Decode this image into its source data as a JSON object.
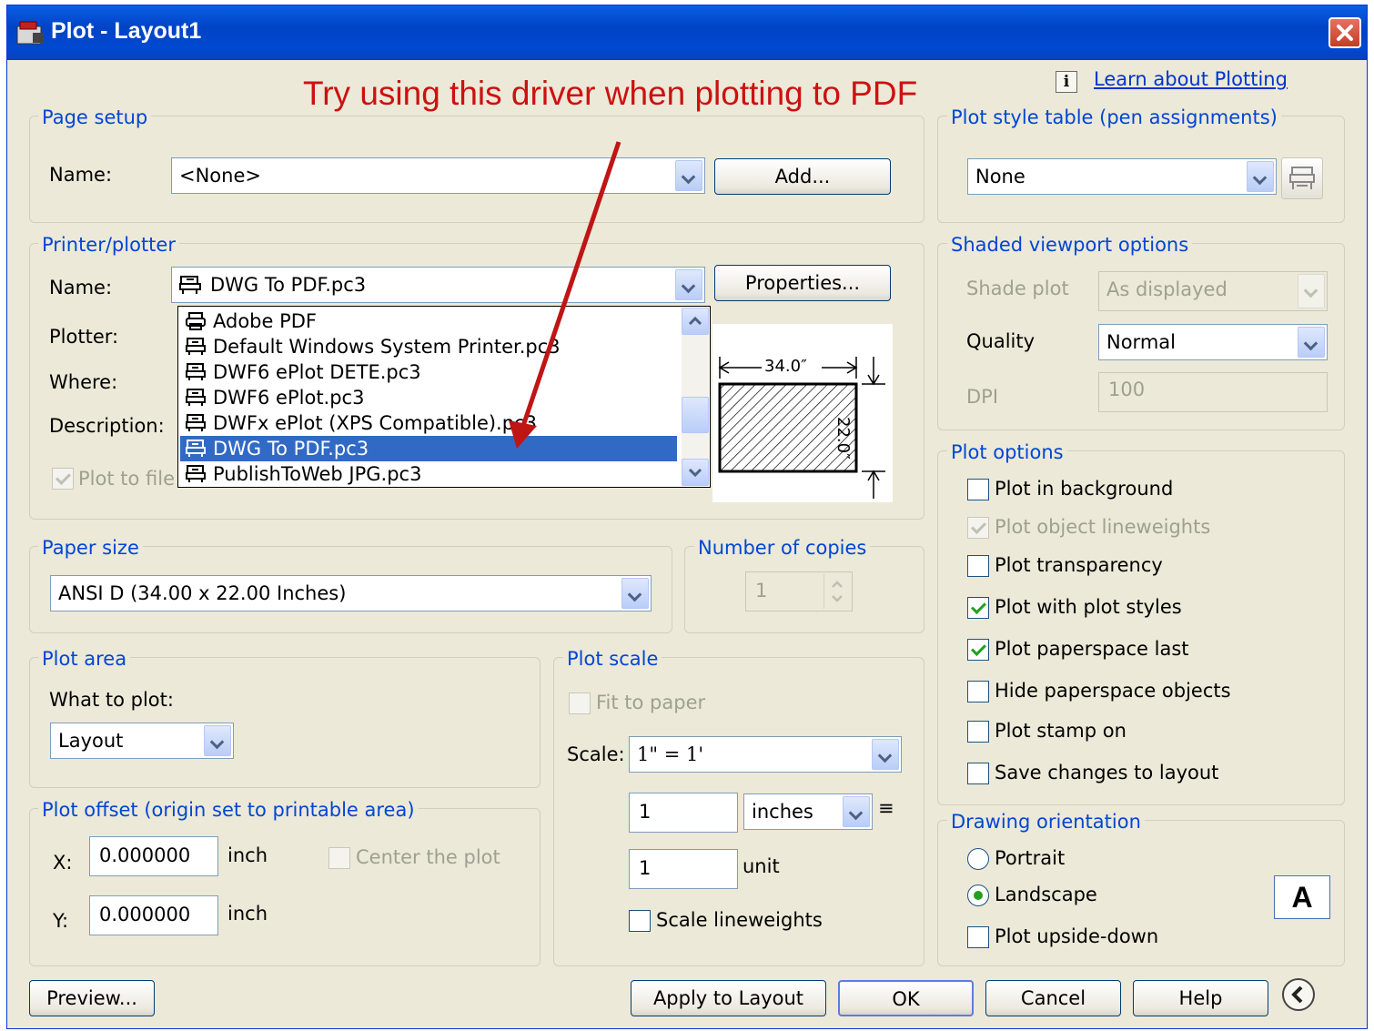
{
  "window": {
    "title": "Plot - Layout1"
  },
  "annotation": "Try using this driver when plotting to PDF",
  "learn_link": "Learn about Plotting",
  "info_glyph": "i",
  "page_setup": {
    "legend": "Page setup",
    "name_label": "Name:",
    "name_value": "<None>",
    "add_button": "Add..."
  },
  "printer": {
    "legend": "Printer/plotter",
    "name_label": "Name:",
    "name_value": "DWG To PDF.pc3",
    "properties_button": "Properties...",
    "plotter_label": "Plotter:",
    "where_label": "Where:",
    "description_label": "Description:",
    "plot_to_file": "Plot to file",
    "options": [
      {
        "label": "Adobe PDF",
        "icon": "printer-icon"
      },
      {
        "label": "Default Windows System Printer.pc3",
        "icon": "plotter-icon"
      },
      {
        "label": "DWF6 ePlot DETE.pc3",
        "icon": "plotter-icon"
      },
      {
        "label": "DWF6 ePlot.pc3",
        "icon": "plotter-icon"
      },
      {
        "label": "DWFx ePlot (XPS Compatible).pc3",
        "icon": "plotter-icon"
      },
      {
        "label": "DWG To PDF.pc3",
        "icon": "plotter-icon",
        "selected": true
      },
      {
        "label": "PublishToWeb JPG.pc3",
        "icon": "plotter-icon"
      }
    ],
    "preview": {
      "width_label": "34.0″",
      "height_label": "22.0″"
    }
  },
  "paper_size": {
    "legend": "Paper size",
    "value": "ANSI D (34.00 x 22.00 Inches)"
  },
  "copies": {
    "legend": "Number of copies",
    "value": "1"
  },
  "plot_area": {
    "legend": "Plot area",
    "what_label": "What to plot:",
    "value": "Layout"
  },
  "plot_offset": {
    "legend": "Plot offset (origin set to printable area)",
    "x_label": "X:",
    "x_value": "0.000000",
    "x_unit": "inch",
    "y_label": "Y:",
    "y_value": "0.000000",
    "y_unit": "inch",
    "center_label": "Center the plot"
  },
  "plot_scale": {
    "legend": "Plot scale",
    "fit_label": "Fit to paper",
    "scale_label": "Scale:",
    "scale_value": "1\" = 1'",
    "value1": "1",
    "unit1": "inches",
    "equals": "≡",
    "value2": "1",
    "unit2": "unit",
    "lineweights_label": "Scale lineweights"
  },
  "plot_style": {
    "legend": "Plot style table (pen assignments)",
    "value": "None"
  },
  "shaded": {
    "legend": "Shaded viewport options",
    "shade_label": "Shade plot",
    "shade_value": "As displayed",
    "quality_label": "Quality",
    "quality_value": "Normal",
    "dpi_label": "DPI",
    "dpi_value": "100"
  },
  "plot_options": {
    "legend": "Plot options",
    "items": [
      {
        "label": "Plot in background",
        "checked": false,
        "disabled": false
      },
      {
        "label": "Plot object lineweights",
        "checked": true,
        "disabled": true
      },
      {
        "label": "Plot transparency",
        "checked": false,
        "disabled": false
      },
      {
        "label": "Plot with plot styles",
        "checked": true,
        "disabled": false
      },
      {
        "label": "Plot paperspace last",
        "checked": true,
        "disabled": false
      },
      {
        "label": "Hide paperspace objects",
        "checked": false,
        "disabled": false
      },
      {
        "label": "Plot stamp on",
        "checked": false,
        "disabled": false
      },
      {
        "label": "Save changes to layout",
        "checked": false,
        "disabled": false
      }
    ]
  },
  "orientation": {
    "legend": "Drawing orientation",
    "portrait": "Portrait",
    "landscape": "Landscape",
    "upside_down": "Plot upside-down",
    "preview_glyph": "A"
  },
  "buttons": {
    "preview": "Preview...",
    "apply": "Apply to Layout",
    "ok": "OK",
    "cancel": "Cancel",
    "help": "Help"
  },
  "colors": {
    "title_bar": "#0054e3",
    "legend_text": "#0046d5",
    "selection": "#316ac5",
    "annotation": "#cc1111"
  }
}
